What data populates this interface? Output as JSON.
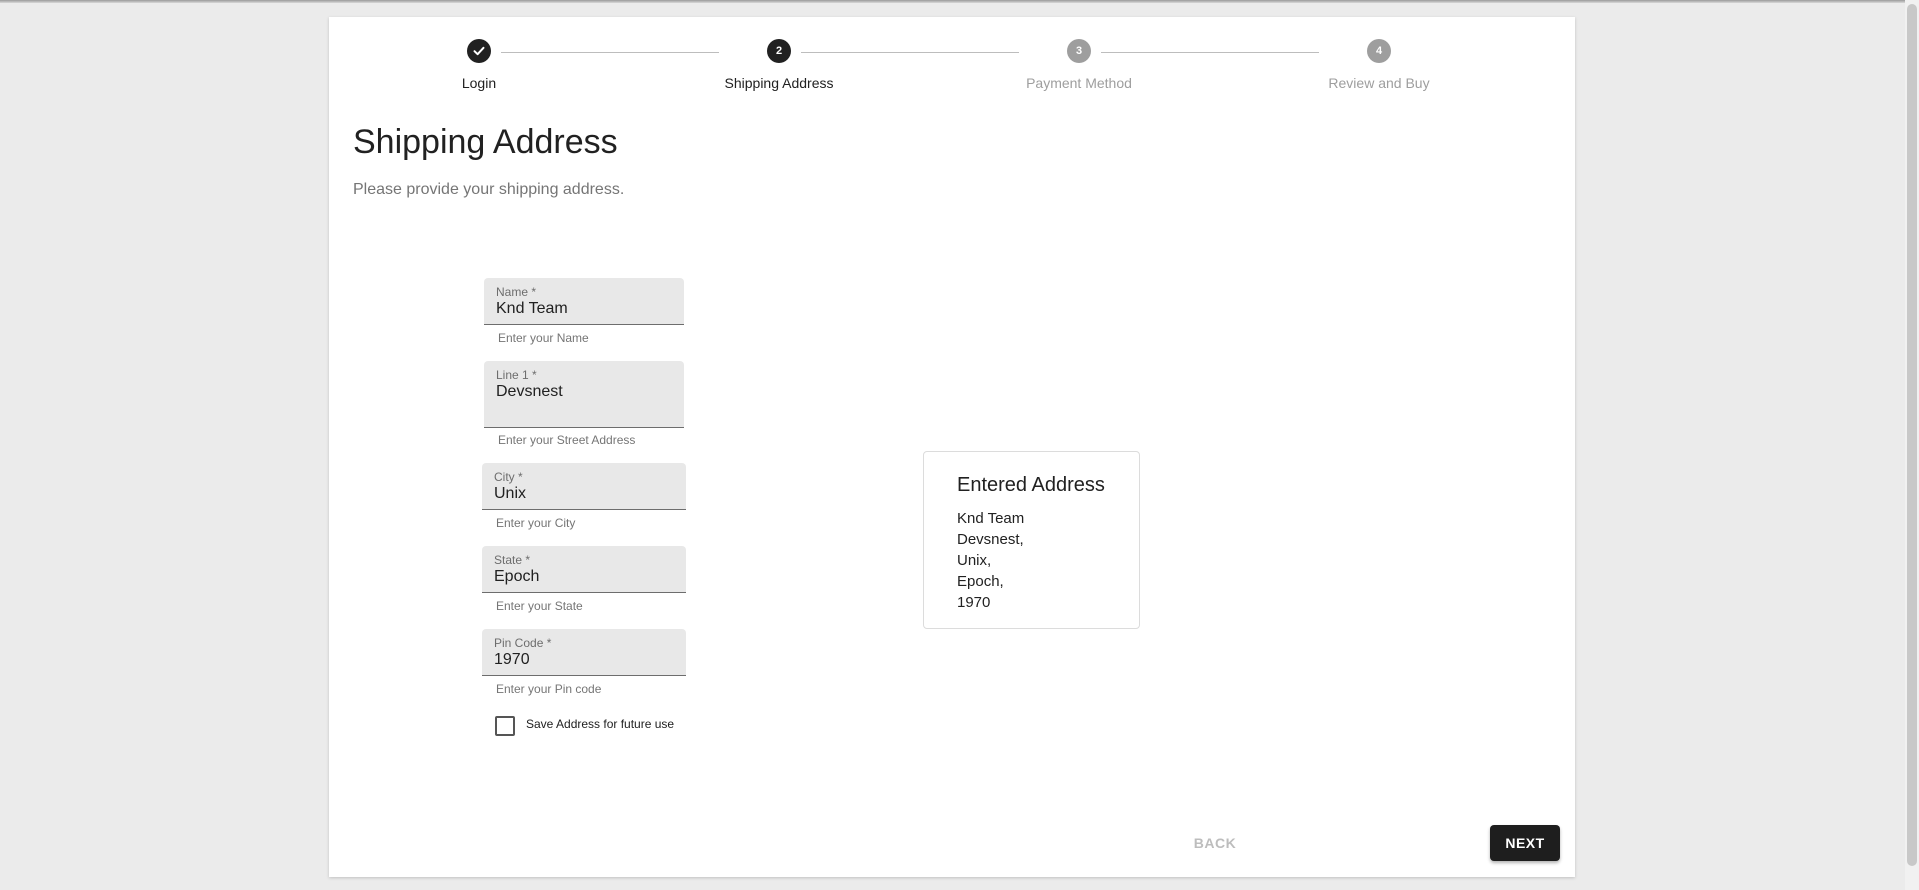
{
  "stepper": {
    "steps": [
      {
        "number": "",
        "label": "Login",
        "state": "completed"
      },
      {
        "number": "2",
        "label": "Shipping Address",
        "state": "active"
      },
      {
        "number": "3",
        "label": "Payment Method",
        "state": "pending"
      },
      {
        "number": "4",
        "label": "Review and Buy",
        "state": "pending"
      }
    ]
  },
  "page": {
    "title": "Shipping Address",
    "subtitle": "Please provide your shipping address."
  },
  "form": {
    "name": {
      "label": "Name *",
      "value": "Knd Team",
      "helper": "Enter your Name"
    },
    "line1": {
      "label": "Line 1 *",
      "value": "Devsnest",
      "helper": "Enter your Street Address"
    },
    "city": {
      "label": "City *",
      "value": "Unix",
      "helper": "Enter your City"
    },
    "state": {
      "label": "State *",
      "value": "Epoch",
      "helper": "Enter your State"
    },
    "pincode": {
      "label": "Pin Code *",
      "value": "1970",
      "helper": "Enter your Pin code"
    },
    "save_address": {
      "label": "Save Address for future use",
      "checked": false
    }
  },
  "entered_address": {
    "title": "Entered Address",
    "lines": [
      "Knd Team",
      "Devsnest,",
      "Unix,",
      "Epoch,",
      "1970"
    ]
  },
  "actions": {
    "back_label": "BACK",
    "next_label": "NEXT"
  },
  "colors": {
    "accent": "#1e1e1e",
    "pending": "#9e9e9e",
    "field_bg": "#e8e8e8"
  }
}
